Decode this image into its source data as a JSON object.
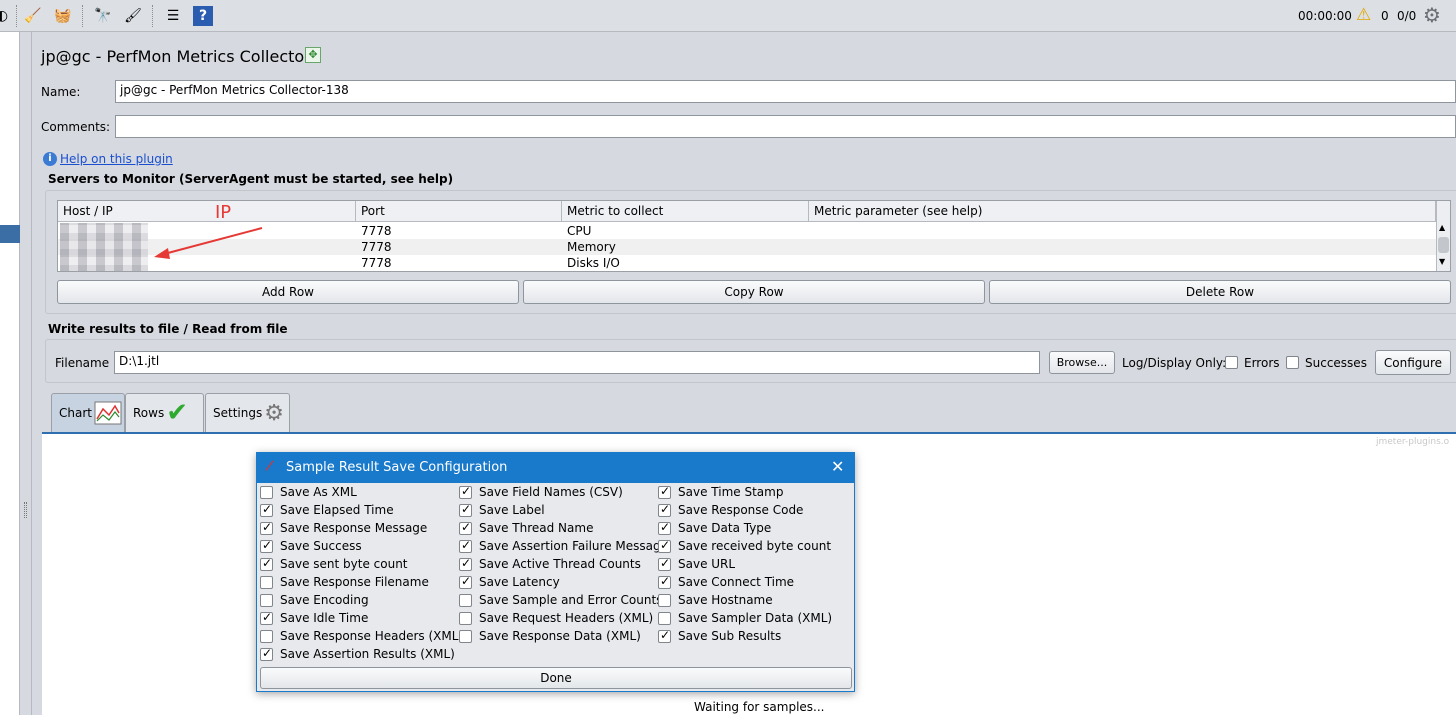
{
  "toolbar": {
    "icons": [
      "broom-icon",
      "broom-all-icon",
      "binoculars-icon",
      "clear-icon",
      "function-icon",
      "help-icon"
    ],
    "timer": "00:00:00",
    "warning_count": "0",
    "thread_count": "0/0",
    "gear_icon": "gear-icon"
  },
  "panel": {
    "title": "jp@gc - PerfMon Metrics Collector",
    "name_label": "Name:",
    "name_value": "jp@gc - PerfMon Metrics Collector-138",
    "comments_label": "Comments:",
    "comments_value": "",
    "help_link": "Help on this plugin"
  },
  "servers": {
    "section_title": "Servers to Monitor (ServerAgent must be started, see help)",
    "columns": [
      "Host / IP",
      "Port",
      "Metric to collect",
      "Metric parameter (see help)"
    ],
    "rows": [
      {
        "host": "",
        "port": "7778",
        "metric": "CPU",
        "param": ""
      },
      {
        "host": "",
        "port": "7778",
        "metric": "Memory",
        "param": ""
      },
      {
        "host": "",
        "port": "7778",
        "metric": "Disks I/O",
        "param": ""
      }
    ],
    "annotation": "IP",
    "add_row": "Add Row",
    "copy_row": "Copy Row",
    "delete_row": "Delete Row"
  },
  "file": {
    "section_title": "Write results to file / Read from file",
    "filename_label": "Filename",
    "filename_value": "D:\\1.jtl",
    "browse": "Browse...",
    "log_label": "Log/Display Only:",
    "errors_label": "Errors",
    "successes_label": "Successes",
    "configure": "Configure"
  },
  "tabs": [
    {
      "label": "Chart",
      "active": true
    },
    {
      "label": "Rows",
      "active": false
    },
    {
      "label": "Settings",
      "active": false
    }
  ],
  "chart": {
    "watermark": "jmeter-plugins.o",
    "status": "Waiting for samples..."
  },
  "dialog": {
    "title": "Sample Result Save Configuration",
    "done": "Done",
    "options": [
      {
        "label": "Save As XML",
        "checked": false
      },
      {
        "label": "Save Field Names (CSV)",
        "checked": true
      },
      {
        "label": "Save Time Stamp",
        "checked": true
      },
      {
        "label": "Save Elapsed Time",
        "checked": true
      },
      {
        "label": "Save Label",
        "checked": true
      },
      {
        "label": "Save Response Code",
        "checked": true
      },
      {
        "label": "Save Response Message",
        "checked": true
      },
      {
        "label": "Save Thread Name",
        "checked": true
      },
      {
        "label": "Save Data Type",
        "checked": true
      },
      {
        "label": "Save Success",
        "checked": true
      },
      {
        "label": "Save Assertion Failure Message",
        "checked": true
      },
      {
        "label": "Save received byte count",
        "checked": true
      },
      {
        "label": "Save sent byte count",
        "checked": true
      },
      {
        "label": "Save Active Thread Counts",
        "checked": true
      },
      {
        "label": "Save URL",
        "checked": true
      },
      {
        "label": "Save Response Filename",
        "checked": false
      },
      {
        "label": "Save Latency",
        "checked": true
      },
      {
        "label": "Save Connect Time",
        "checked": true
      },
      {
        "label": "Save Encoding",
        "checked": false
      },
      {
        "label": "Save Sample and Error Counts",
        "checked": false
      },
      {
        "label": "Save Hostname",
        "checked": false
      },
      {
        "label": "Save Idle Time",
        "checked": true
      },
      {
        "label": "Save Request Headers (XML)",
        "checked": false
      },
      {
        "label": "Save Sampler Data (XML)",
        "checked": false
      },
      {
        "label": "Save Response Headers (XML)",
        "checked": false
      },
      {
        "label": "Save Response Data (XML)",
        "checked": false
      },
      {
        "label": "Save Sub Results",
        "checked": true
      },
      {
        "label": "Save Assertion Results (XML)",
        "checked": true
      }
    ]
  },
  "colors": {
    "accent": "#1979ca",
    "annotation": "#e53935"
  }
}
